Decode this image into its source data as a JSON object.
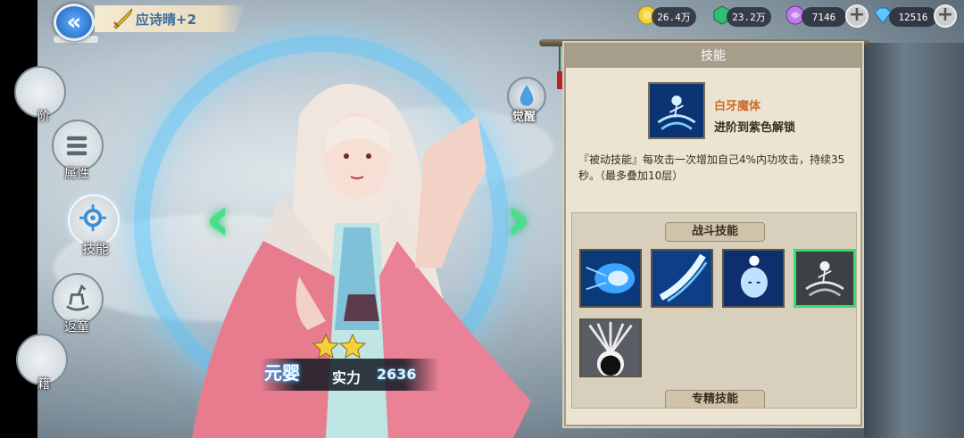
{
  "header": {
    "back_glyph": "«",
    "title": "应诗晴+2"
  },
  "resources": [
    {
      "name": "gold",
      "value": "26.4万",
      "color": "#f3d23a"
    },
    {
      "name": "jade",
      "value": "23.2万",
      "color": "#2fbf6f"
    },
    {
      "name": "spirit",
      "value": "7146",
      "color": "#c07be8"
    },
    {
      "name": "diamond",
      "value": "12516",
      "color": "#5ec6ff"
    }
  ],
  "side_nav": [
    {
      "label": "阶"
    },
    {
      "label": "属性"
    },
    {
      "label": "技能"
    },
    {
      "label": "返童"
    },
    {
      "label": "籍"
    }
  ],
  "hero": {
    "awaken_label": "觉醒",
    "stars": 2,
    "realm": "元婴",
    "power_label": "实力",
    "power_value": "2636"
  },
  "skill_panel": {
    "header": "技能",
    "selected_skill": {
      "name": "白牙魔体",
      "unlock": "进阶到紫色解锁",
      "description": "『被动技能』每攻击一次增加自己4%内功攻击，持续35秒。（最多叠加10层）"
    },
    "combat_title": "战斗技能",
    "next_title": "专精技能",
    "skills": [
      {
        "icon": "lightning-sphere-icon",
        "selected": false
      },
      {
        "icon": "water-slash-icon",
        "selected": false
      },
      {
        "icon": "spirit-face-icon",
        "selected": false
      },
      {
        "icon": "whirlwind-figure-icon",
        "selected": true
      },
      {
        "icon": "dark-burst-icon",
        "selected": false
      }
    ]
  }
}
